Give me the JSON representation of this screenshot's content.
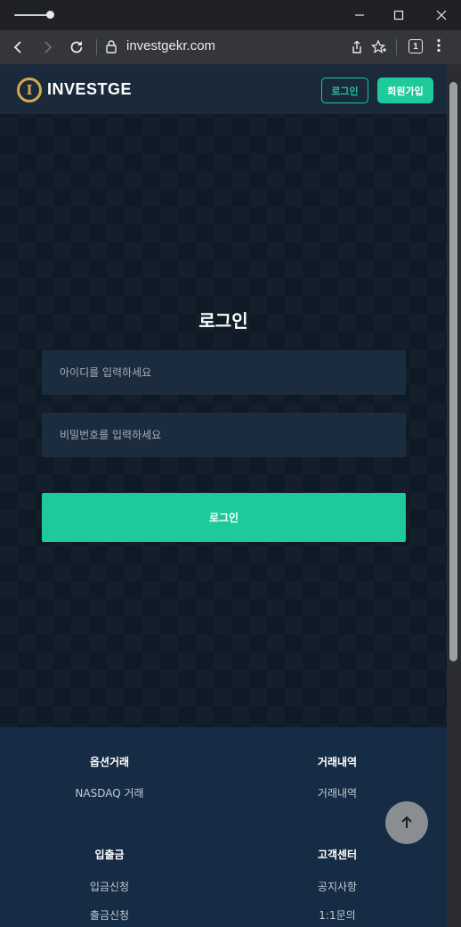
{
  "browser": {
    "url": "investgekr.com",
    "tab_count": "1"
  },
  "header": {
    "logo_mark": "I",
    "logo_text": "INVESTGE",
    "login_label": "로그인",
    "signup_label": "회원가입"
  },
  "login": {
    "title": "로그인",
    "id_placeholder": "아이디를 입력하세요",
    "pw_placeholder": "비밀번호를 입력하세요",
    "submit_label": "로그인"
  },
  "footer": {
    "sections": [
      {
        "heading": "옵션거래",
        "links": [
          "NASDAQ 거래"
        ]
      },
      {
        "heading": "거래내역",
        "links": [
          "거래내역"
        ]
      },
      {
        "heading": "입출금",
        "links": [
          "입금신청",
          "출금신청"
        ]
      },
      {
        "heading": "고객센터",
        "links": [
          "공지사항",
          "1:1문의"
        ]
      }
    ]
  },
  "colors": {
    "accent": "#1ec99b",
    "background": "#0f1a27",
    "input_bg": "#1c2c3f",
    "footer_bg": "#162c44",
    "logo_gold": "#d6a84a"
  },
  "icons": [
    "back-icon",
    "forward-icon",
    "reload-icon",
    "lock-icon",
    "share-icon",
    "bookmark-icon",
    "tab-count-icon",
    "menu-icon",
    "minimize-icon",
    "maximize-icon",
    "close-icon",
    "arrow-up-icon"
  ]
}
